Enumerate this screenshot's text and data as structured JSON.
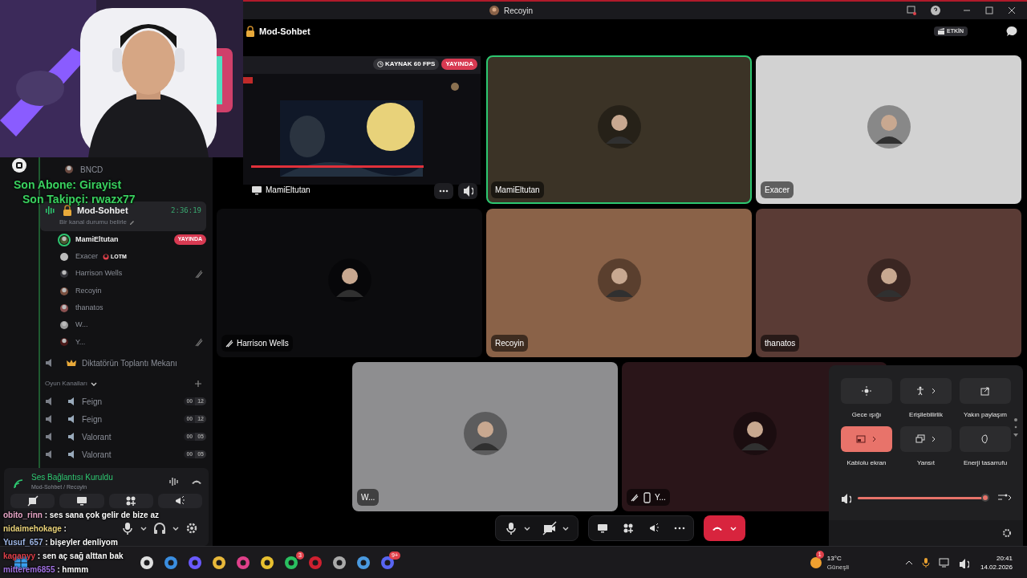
{
  "title_bar": {
    "title": "Recoyin"
  },
  "overlay": {
    "last_sub": "Son Abone: Girayist",
    "last_follow": "Son Takipçi: rwazx77",
    "chat": [
      {
        "user": "obito_rinn",
        "color": "#e9a6c8",
        "message": " : ses sana çok gelir de bize az"
      },
      {
        "user": "nidaimehokage",
        "color": "#e8d27a",
        "message": " :"
      },
      {
        "user": "Yusuf_657",
        "color": "#9fb7e6",
        "message": " : bişeyler denliyom"
      },
      {
        "user": "kaganyy",
        "color": "#e0404a",
        "message": " : sen aç sağ alttan bak"
      },
      {
        "user": "mitterem6855",
        "color": "#a070e0",
        "message": " : hmmm"
      }
    ]
  },
  "sidebar": {
    "users_above": [
      {
        "name": "BNCD"
      }
    ],
    "active_channel": {
      "name": "Mod-Sohbet",
      "timer": "2:36:19",
      "status_hint": "Bir kanal durumu belirle",
      "selected": true
    },
    "members": [
      {
        "name": "MamiEltutan",
        "speaking": true,
        "muted": false,
        "badge": "YAYINDA"
      },
      {
        "name": "Exacer",
        "speaking": false,
        "muted": false,
        "tag": "LOTM"
      },
      {
        "name": "Harrison Wells",
        "speaking": false,
        "muted": true
      },
      {
        "name": "Recoyin",
        "speaking": false,
        "muted": false
      },
      {
        "name": "thanatos",
        "speaking": false,
        "muted": false
      },
      {
        "name": "W...",
        "speaking": false,
        "muted": false
      },
      {
        "name": "Y...",
        "speaking": false,
        "muted": true
      }
    ],
    "channels": [
      {
        "name": "Diktatörün Toplantı Mekanı"
      }
    ],
    "category": {
      "name": "Oyun Kanalları",
      "channels": [
        {
          "name": "Feign",
          "count": "00",
          "limit": "12"
        },
        {
          "name": "Feign",
          "count": "00",
          "limit": "12"
        },
        {
          "name": "Valorant",
          "count": "00",
          "limit": "05"
        },
        {
          "name": "Valorant",
          "count": "00",
          "limit": "05"
        }
      ]
    },
    "voice_panel": {
      "status": "Ses Bağlantısı Kuruldu",
      "location": "Mod-Sohbet / Recoyin"
    }
  },
  "call": {
    "channel": "Mod-Sohbet",
    "activity_badge": "ETKİN",
    "tiles": [
      {
        "kind": "stream",
        "name": "MamiEltutan",
        "badges": [
          "KAYNAK 60 FPS",
          "YAYINDA"
        ]
      },
      {
        "kind": "user",
        "name": "MamiEltutan",
        "color": "#3b3326",
        "speaking": true,
        "muted": false,
        "mobile": false
      },
      {
        "kind": "user",
        "name": "Exacer",
        "color": "#d2d2d2",
        "speaking": false,
        "muted": false,
        "mobile": false
      },
      {
        "kind": "user",
        "name": "Harrison Wells",
        "color": "#0c0c0e",
        "speaking": false,
        "muted": true,
        "mobile": false
      },
      {
        "kind": "user",
        "name": "Recoyin",
        "color": "#8a6248",
        "speaking": false,
        "muted": false,
        "mobile": false
      },
      {
        "kind": "user",
        "name": "thanatos",
        "color": "#5a3b35",
        "speaking": false,
        "muted": false,
        "mobile": false
      },
      {
        "kind": "user",
        "name": "W...",
        "color": "#8e8e90",
        "speaking": false,
        "muted": false,
        "mobile": false
      },
      {
        "kind": "user",
        "name": "Y...",
        "color": "#2a1519",
        "speaking": false,
        "muted": true,
        "mobile": true
      }
    ]
  },
  "quick_settings": {
    "tiles": [
      {
        "label": "Gece ışığı",
        "on": false,
        "expandable": false
      },
      {
        "label": "Erişilebilirlik",
        "on": false,
        "expandable": true
      },
      {
        "label": "Yakın paylaşım",
        "on": false,
        "expandable": false
      },
      {
        "label": "Kablolu ekran",
        "on": true,
        "expandable": true
      },
      {
        "label": "Yansıt",
        "on": false,
        "expandable": true
      },
      {
        "label": "Enerji tasarrufu",
        "on": false,
        "expandable": false
      }
    ],
    "volume": {
      "level": 0.98
    }
  },
  "taskbar": {
    "apps": [
      {
        "badge": "3"
      },
      {
        "badge": "9+"
      }
    ],
    "weather": {
      "badge": "1",
      "temp": "13°C",
      "condition": "Güneşli"
    },
    "time": "20:41",
    "date": "14.02.2026"
  }
}
